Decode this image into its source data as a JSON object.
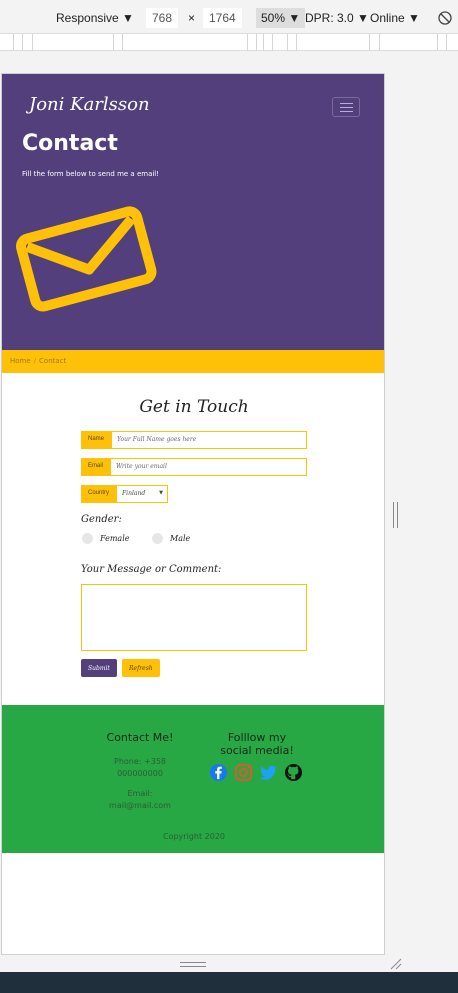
{
  "devtools": {
    "device_mode": "Responsive",
    "width": "768",
    "times": "×",
    "height": "1764",
    "zoom": "50%",
    "dpr": "DPR: 3.0",
    "network": "Online",
    "caret": "▼"
  },
  "page": {
    "brand": "Joni Karlsson",
    "hero_title": "Contact",
    "hero_subtitle": "Fill the form below to send me a email!",
    "breadcrumb": {
      "home": "Home",
      "separator": "/",
      "current": "Contact"
    },
    "form": {
      "title": "Get in Touch",
      "name_label": "Name",
      "name_placeholder": "Your Full Name goes here",
      "email_label": "Email",
      "email_placeholder": "Write your email",
      "country_label": "Country",
      "country_value": "Finland",
      "gender_label": "Gender:",
      "gender_options": [
        "Female",
        "Male"
      ],
      "message_label": "Your Message or Comment:",
      "submit_label": "Submit",
      "refresh_label": "Refresh"
    },
    "footer": {
      "contact_heading": "Contact Me!",
      "phone_line1": "Phone: +358",
      "phone_line2": "000000000",
      "email_line1": "Email:",
      "email_line2": "mail@mail.com",
      "social_heading_line1": "Folllow my",
      "social_heading_line2": "social media!",
      "social_icons": [
        "facebook-icon",
        "instagram-icon",
        "twitter-icon",
        "github-icon"
      ],
      "copyright": "Copyright 2020"
    }
  },
  "colors": {
    "purple": "#533f7c",
    "yellow": "#ffc107",
    "green": "#28a745",
    "facebook": "#1877f2",
    "instagram": "#e4572e",
    "twitter": "#1da1f2",
    "github": "#111111"
  }
}
